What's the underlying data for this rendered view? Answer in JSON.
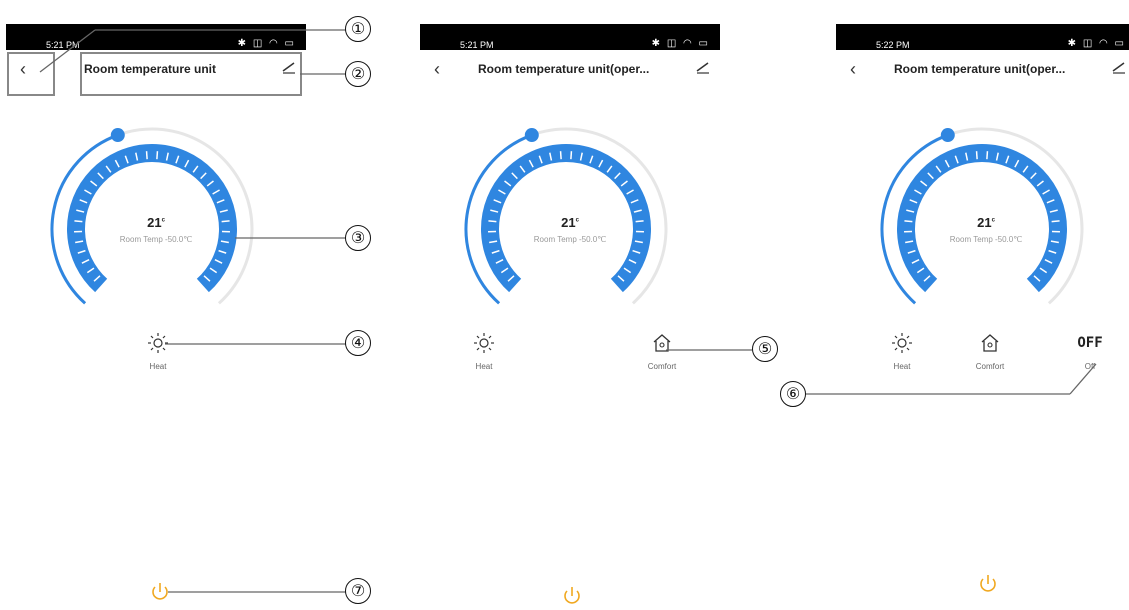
{
  "screens": [
    {
      "status_time": "5:21 PM",
      "status_icons": "✱ ◫ ◠ ▭",
      "title": "Room temperature unit",
      "temperature": "21",
      "temp_unit": "c",
      "room_temp": "Room Temp -50.0℃",
      "modes": [
        {
          "label": "Heat",
          "icon": "sun-icon"
        }
      ]
    },
    {
      "status_time": "5:21 PM",
      "status_icons": "✱ ◫ ◠ ▭",
      "title": "Room temperature unit(oper...",
      "temperature": "21",
      "temp_unit": "c",
      "room_temp": "Room Temp -50.0℃",
      "modes": [
        {
          "label": "Heat",
          "icon": "sun-icon"
        },
        {
          "label": "Comfort",
          "icon": "home-icon"
        }
      ]
    },
    {
      "status_time": "5:22 PM",
      "status_icons": "✱ ◫ ◠ ▭",
      "title": "Room temperature unit(oper...",
      "temperature": "21",
      "temp_unit": "c",
      "room_temp": "Room Temp -50.0℃",
      "modes": [
        {
          "label": "Heat",
          "icon": "sun-icon"
        },
        {
          "label": "Comfort",
          "icon": "home-icon"
        },
        {
          "label": "Off",
          "icon": "off-text-icon",
          "icon_text": "OFF"
        }
      ]
    }
  ],
  "callouts": [
    "①",
    "②",
    "③",
    "④",
    "⑤",
    "⑥",
    "⑦"
  ],
  "colors": {
    "accent": "#2f86e0",
    "track": "#e6e6e6",
    "power": "#f0a820",
    "status_bar": "#000000"
  }
}
